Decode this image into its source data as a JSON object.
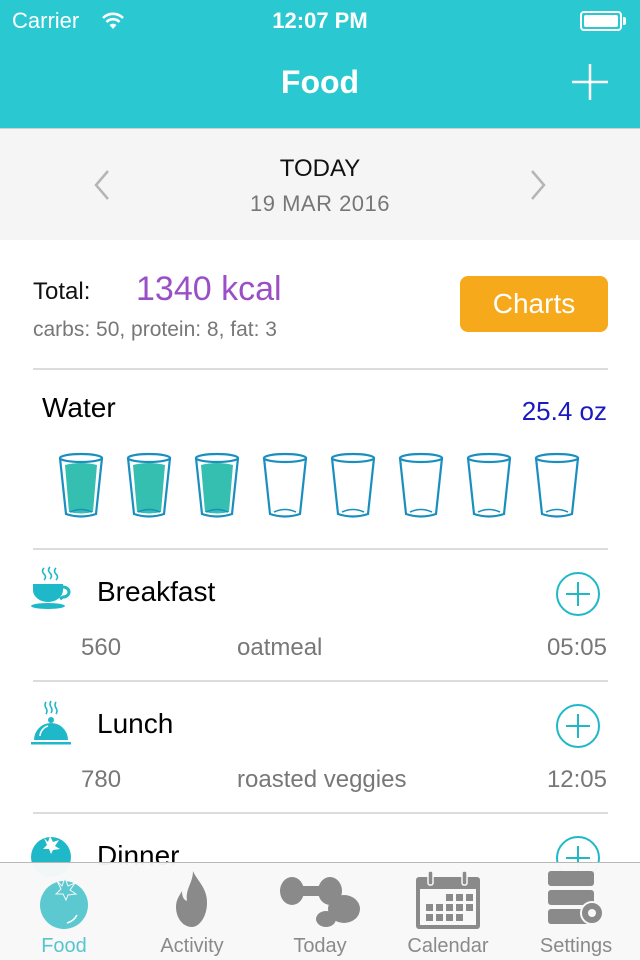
{
  "status_bar": {
    "carrier": "Carrier",
    "time": "12:07 PM",
    "wifi_icon": "wifi-icon",
    "battery_icon": "battery-full-icon"
  },
  "header": {
    "title": "Food",
    "add_icon": "plus-icon",
    "color": "#2ac8d0"
  },
  "date_nav": {
    "title": "TODAY",
    "date": "19 MAR 2016",
    "prev_icon": "chevron-left-icon",
    "next_icon": "chevron-right-icon"
  },
  "summary": {
    "total_label": "Total:",
    "total_value": "1340 kcal",
    "macros": "carbs: 50, protein: 8, fat: 3",
    "charts_button": "Charts",
    "total_color": "#9b4fc6",
    "charts_color": "#f7a91c"
  },
  "water": {
    "title": "Water",
    "amount": "25.4 oz",
    "glasses_total": 8,
    "glasses_filled": 3,
    "fill_color": "#35bfb0",
    "outline_color": "#1a8fbf"
  },
  "meals": [
    {
      "title": "Breakfast",
      "icon": "coffee-cup-icon",
      "entries": [
        {
          "kcal": "560",
          "name": "oatmeal",
          "time": "05:05"
        }
      ]
    },
    {
      "title": "Lunch",
      "icon": "cloche-icon",
      "entries": [
        {
          "kcal": "780",
          "name": "roasted veggies",
          "time": "12:05"
        }
      ]
    },
    {
      "title": "Dinner",
      "icon": "tomato-icon",
      "entries": []
    }
  ],
  "tabbar": {
    "active": "Food",
    "tabs": [
      {
        "label": "Food",
        "icon": "tomato-icon"
      },
      {
        "label": "Activity",
        "icon": "flame-icon"
      },
      {
        "label": "Today",
        "icon": "dumbbell-icon"
      },
      {
        "label": "Calendar",
        "icon": "calendar-icon"
      },
      {
        "label": "Settings",
        "icon": "settings-stack-icon"
      }
    ]
  }
}
